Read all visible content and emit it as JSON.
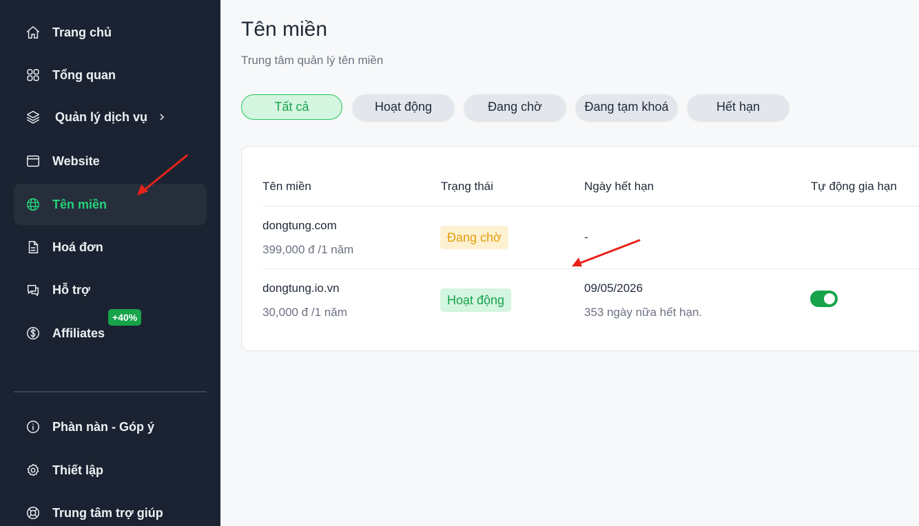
{
  "sidebar": {
    "items": [
      {
        "label": "Trang chủ",
        "icon": "home-icon"
      },
      {
        "label": "Tổng quan",
        "icon": "grid-icon"
      },
      {
        "label": "Quản lý dịch vụ",
        "icon": "layers-icon"
      },
      {
        "label": "Website",
        "icon": "browser-icon"
      },
      {
        "label": "Tên miền",
        "icon": "globe-icon",
        "active": true
      },
      {
        "label": "Hoá đơn",
        "icon": "invoice-icon"
      },
      {
        "label": "Hỗ trợ",
        "icon": "chat-icon"
      },
      {
        "label": "Affiliates",
        "icon": "dollar-icon",
        "badge": "+40%"
      }
    ],
    "bottom_items": [
      {
        "label": "Phàn nàn - Góp ý",
        "icon": "info-icon"
      },
      {
        "label": "Thiết lập",
        "icon": "gear-icon"
      },
      {
        "label": "Trung tâm trợ giúp",
        "icon": "lifebuoy-icon"
      }
    ]
  },
  "page": {
    "title": "Tên miền",
    "subtitle": "Trung tâm quản lý tên miền"
  },
  "filters": [
    "Tất cả",
    "Hoạt động",
    "Đang chờ",
    "Đang tạm khoá",
    "Hết hạn"
  ],
  "table": {
    "headers": [
      "Tên miền",
      "Trạng thái",
      "Ngày hết hạn",
      "Tự động gia hạn"
    ],
    "rows": [
      {
        "domain": "dongtung.com",
        "price": "399,000 đ /1 năm",
        "status": "Đang chờ",
        "expiry": "-",
        "remaining": "",
        "auto_renew": null
      },
      {
        "domain": "dongtung.io.vn",
        "price": "30,000 đ /1 năm",
        "status": "Hoạt động",
        "expiry": "09/05/2026",
        "remaining": "353 ngày nữa hết hạn.",
        "auto_renew": true
      }
    ]
  },
  "colors": {
    "sidebar_bg": "#1b2332",
    "accent": "#26d07c",
    "arrow": "#e8221b"
  }
}
